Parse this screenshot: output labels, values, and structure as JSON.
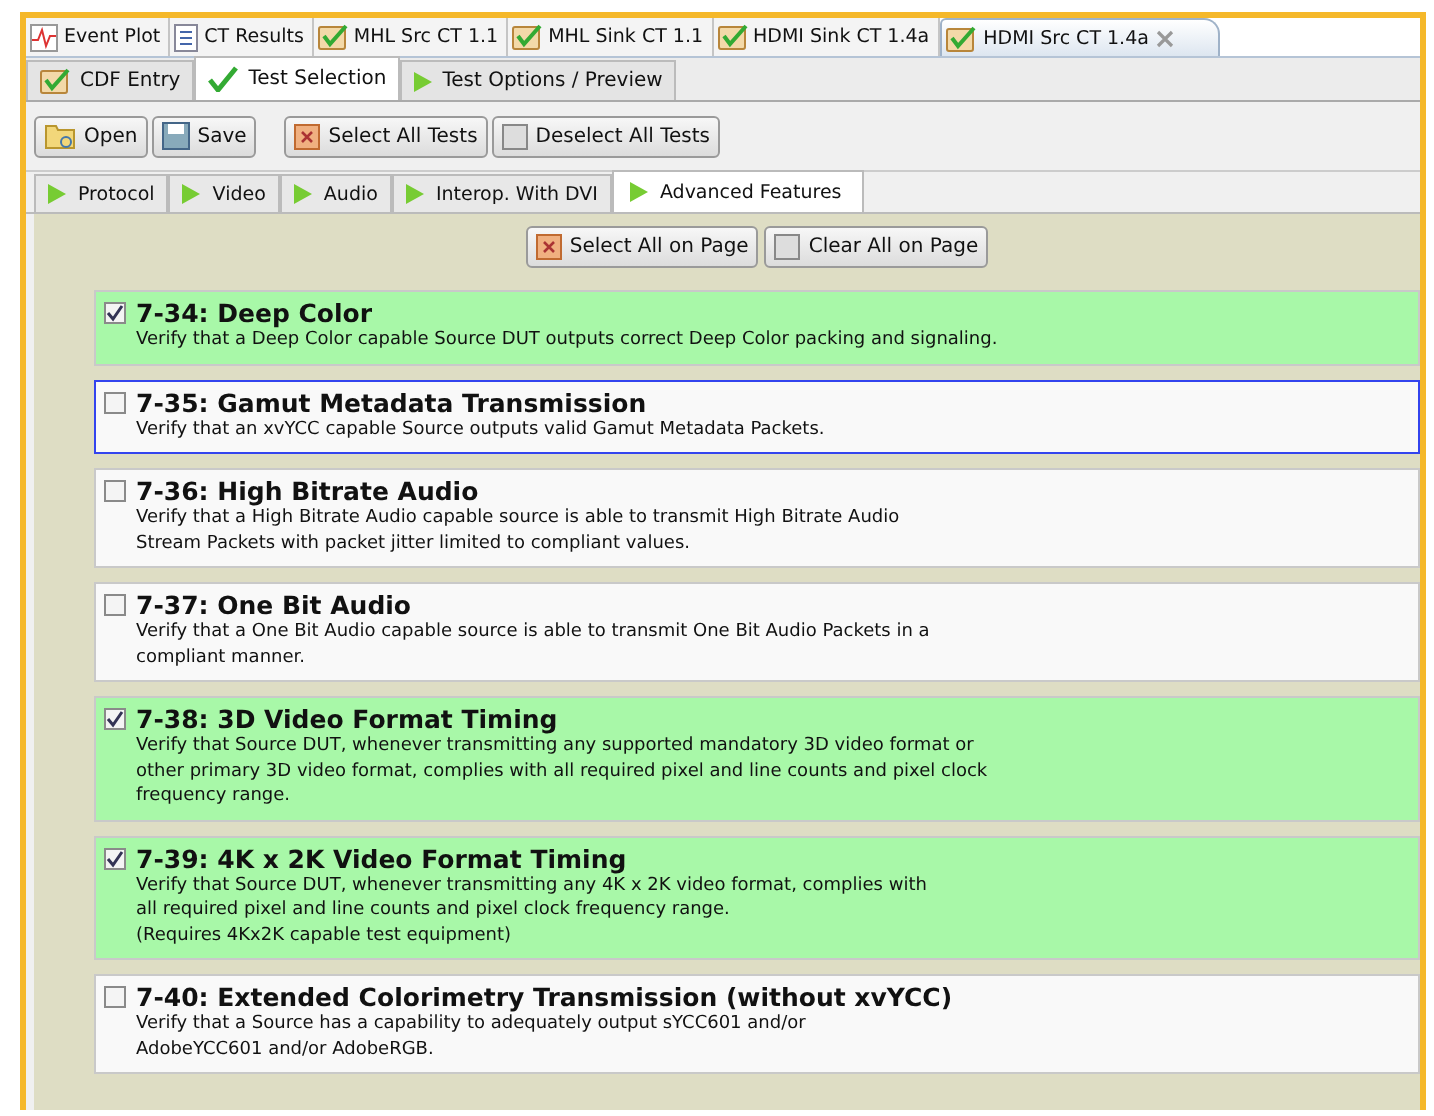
{
  "editor_tabs": [
    {
      "label": "Event Plot",
      "kind": "plot",
      "selected": false
    },
    {
      "label": "CT Results",
      "kind": "doc",
      "selected": false
    },
    {
      "label": "MHL Src CT 1.1",
      "kind": "ct",
      "selected": false
    },
    {
      "label": "MHL Sink CT 1.1",
      "kind": "ct",
      "selected": false
    },
    {
      "label": "HDMI Sink CT 1.4a",
      "kind": "ct",
      "selected": false
    },
    {
      "label": "HDMI Src CT 1.4a",
      "kind": "ct",
      "selected": true
    }
  ],
  "view_tabs": [
    {
      "label": "CDF Entry",
      "kind": "ct",
      "selected": false
    },
    {
      "label": "Test Selection",
      "kind": "check",
      "selected": true
    },
    {
      "label": "Test Options / Preview",
      "kind": "play",
      "selected": false
    }
  ],
  "toolbar": [
    {
      "label": "Open",
      "kind": "folder"
    },
    {
      "label": "Save",
      "kind": "disk"
    },
    {
      "label": "Select All Tests",
      "kind": "select"
    },
    {
      "label": "Deselect All Tests",
      "kind": "box"
    }
  ],
  "category_tabs": [
    {
      "label": "Protocol",
      "selected": false
    },
    {
      "label": "Video",
      "selected": false
    },
    {
      "label": "Audio",
      "selected": false
    },
    {
      "label": "Interop. With DVI",
      "selected": false
    },
    {
      "label": "Advanced Features",
      "selected": true
    }
  ],
  "page_buttons": [
    {
      "label": "Select All on Page",
      "kind": "select"
    },
    {
      "label": "Clear All on Page",
      "kind": "box"
    }
  ],
  "tests": [
    {
      "title": "7-34: Deep Color",
      "checked": true,
      "focused": false,
      "description": [
        "Verify that a Deep Color capable Source DUT outputs correct Deep Color packing and signaling."
      ]
    },
    {
      "title": "7-35: Gamut Metadata Transmission",
      "checked": false,
      "focused": true,
      "description": [
        "Verify that an xvYCC capable Source outputs valid Gamut Metadata Packets."
      ]
    },
    {
      "title": "7-36: High Bitrate Audio",
      "checked": false,
      "focused": false,
      "description": [
        "Verify that a High Bitrate Audio capable source is able to transmit High Bitrate Audio",
        "Stream Packets with packet jitter limited to compliant values."
      ]
    },
    {
      "title": "7-37: One Bit Audio",
      "checked": false,
      "focused": false,
      "description": [
        "Verify that a One Bit Audio capable source is able to transmit One Bit Audio Packets in a",
        "compliant manner."
      ]
    },
    {
      "title": "7-38: 3D Video Format Timing",
      "checked": true,
      "focused": false,
      "description": [
        "Verify that Source DUT, whenever transmitting any supported mandatory 3D video format or",
        "other primary 3D video format, complies with all required pixel and line counts and pixel clock",
        "frequency range."
      ]
    },
    {
      "title": "7-39: 4K x 2K Video Format Timing",
      "checked": true,
      "focused": false,
      "description": [
        "Verify that Source DUT, whenever transmitting any 4K x 2K video format, complies with",
        "all required pixel and line counts and pixel clock frequency range.",
        "(Requires 4Kx2K capable test equipment)"
      ]
    },
    {
      "title": "7-40: Extended Colorimetry Transmission (without xvYCC)",
      "checked": false,
      "focused": false,
      "description": [
        "Verify that a Source has a capability to adequately output sYCC601 and/or",
        "AdobeYCC601 and/or AdobeRGB."
      ]
    }
  ]
}
